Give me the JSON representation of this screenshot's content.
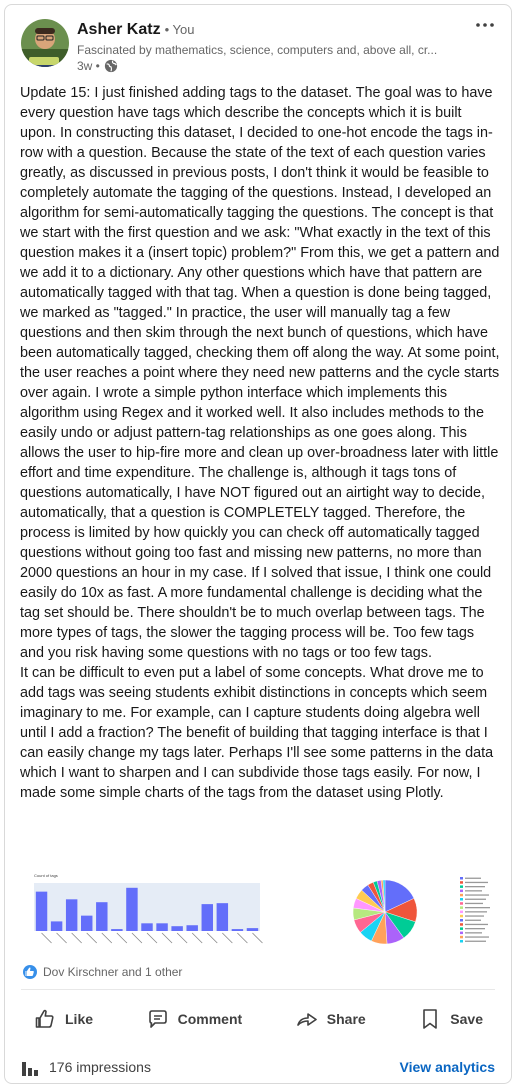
{
  "author": {
    "name": "Asher Katz",
    "you": "• You",
    "headline": "Fascinated by mathematics, science, computers and, above all, cr...",
    "time": "3w •"
  },
  "post": {
    "paragraphs": [
      "Update 15: I just finished adding tags to the dataset. The goal was to have every question have tags which describe the concepts which it is built upon. In constructing this dataset, I decided to one-hot encode the tags in-row with a question. Because the state of the text of each question varies greatly, as discussed in previous posts, I don't think it would be feasible to completely automate the tagging of the questions. Instead, I developed an algorithm for semi-automatically tagging the questions. The concept is that we start with the first question and we ask: \"What exactly in the text of this question makes it a (insert topic) problem?\" From this, we get a pattern and we add it to a dictionary. Any other questions which have that pattern are automatically tagged with that tag. When a question is done being tagged, we marked as \"tagged.\" In practice, the user will manually tag a few questions and then skim through the next bunch of questions, which have been automatically tagged, checking them off along the way. At some point, the user reaches a point where they need new patterns and the cycle starts over again. I wrote a simple python interface which implements this algorithm using Regex and it worked well. It also includes methods to the easily undo or adjust pattern-tag relationships as one goes along. This allows the user to hip-fire more and clean up over-broadness later with little effort and time expenditure. The challenge is, although it tags tons of questions automatically, I have NOT figured out an airtight way to decide, automatically, that a question is COMPLETELY tagged. Therefore, the process is limited by how quickly you can check off automatically tagged questions without going too fast and missing new patterns, no more than 2000 questions an hour in my case. If I solved that issue, I think one could easily do 10x as fast. A more fundamental challenge is deciding what the tag set should be. There shouldn't be to much overlap between tags. The more types of tags, the slower the tagging process will be. Too few tags and you risk having some questions with no tags or too few tags.",
      "It can be difficult to even put a label of some concepts. What drove me to add tags was seeing students exhibit distinctions in concepts which seem imaginary to me. For example, can I capture students doing algebra well until I add a fraction? The benefit of building that tagging interface is that I can easily change my tags later. Perhaps I'll see some patterns in the data which I want to sharpen and I can subdivide those tags easily. For now, I made some simple charts of the tags from the dataset using Plotly."
    ]
  },
  "charts": {
    "bar_title": "Count of tags",
    "bar_color": "#636efa",
    "bar_bg": "#e5ecf6",
    "pie_colors": [
      "#636efa",
      "#ef553b",
      "#00cc96",
      "#ab63fa",
      "#ffa15a",
      "#19d3f3",
      "#ff6692",
      "#b6e880",
      "#ff97ff",
      "#fecb52",
      "#636efa",
      "#ef553b",
      "#00cc96",
      "#ab63fa",
      "#ffa15a",
      "#19d3f3"
    ]
  },
  "chart_data": [
    {
      "type": "bar",
      "title": "Count of tags",
      "values": [
        41,
        10,
        33,
        16,
        30,
        2,
        45,
        8,
        8,
        5,
        6,
        28,
        29,
        2,
        3
      ],
      "ylim": [
        0,
        50
      ]
    },
    {
      "type": "pie",
      "values": [
        18,
        12,
        10,
        9,
        8,
        7,
        7,
        6,
        5,
        5,
        4,
        3,
        2,
        2,
        1,
        1
      ]
    }
  ],
  "reactions": {
    "text": "Dov Kirschner and 1 other"
  },
  "actions": {
    "like": "Like",
    "comment": "Comment",
    "share": "Share",
    "save": "Save"
  },
  "footer": {
    "impressions": "176 impressions",
    "view_analytics": "View analytics"
  },
  "colors": {
    "accent": "#0a66c2",
    "text_primary": "#191919",
    "text_secondary": "#666666"
  }
}
